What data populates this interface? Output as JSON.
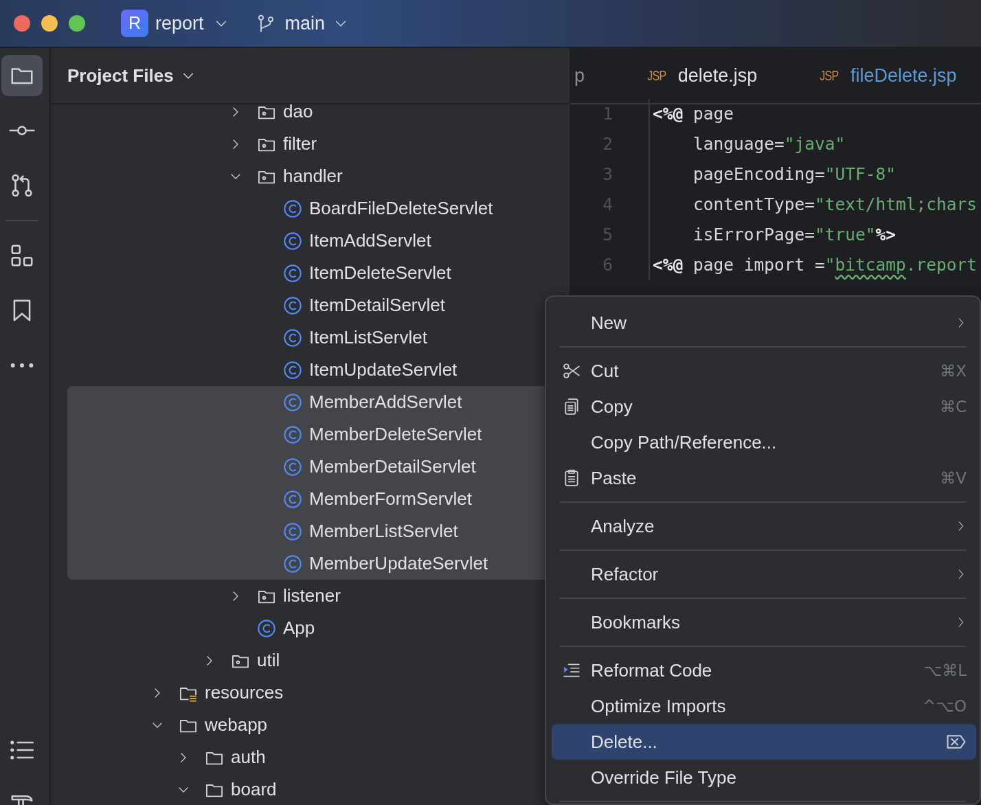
{
  "title_bar": {
    "project": {
      "badge": "R",
      "name": "report"
    },
    "branch": {
      "name": "main"
    }
  },
  "tool_buttons": [
    {
      "selected": true
    },
    {
      "selected": false
    },
    {
      "selected": false
    },
    {
      "selected": false
    },
    {
      "selected": false
    },
    {
      "selected": false
    },
    {
      "selected": false
    },
    {
      "selected": false
    }
  ],
  "project_panel": {
    "title": "Project Files",
    "tree": [
      {
        "children": [
          {
            "children": [
              {
                "children": [
                  {
                    "label": "dao",
                    "kind": "package",
                    "expanded": false,
                    "selected": false
                  },
                  {
                    "label": "filter",
                    "kind": "package",
                    "expanded": false,
                    "selected": false
                  },
                  {
                    "label": "handler",
                    "kind": "package",
                    "expanded": true,
                    "selected": false,
                    "children": [
                      {
                        "label": "BoardFileDeleteServlet",
                        "kind": "class",
                        "selected": false
                      },
                      {
                        "label": "ItemAddServlet",
                        "kind": "class",
                        "selected": false
                      },
                      {
                        "label": "ItemDeleteServlet",
                        "kind": "class",
                        "selected": false
                      },
                      {
                        "label": "ItemDetailServlet",
                        "kind": "class",
                        "selected": false
                      },
                      {
                        "label": "ItemListServlet",
                        "kind": "class",
                        "selected": false
                      },
                      {
                        "label": "ItemUpdateServlet",
                        "kind": "class",
                        "selected": false
                      },
                      {
                        "label": "MemberAddServlet",
                        "kind": "class",
                        "selected": true
                      },
                      {
                        "label": "MemberDeleteServlet",
                        "kind": "class",
                        "selected": true
                      },
                      {
                        "label": "MemberDetailServlet",
                        "kind": "class",
                        "selected": true
                      },
                      {
                        "label": "MemberFormServlet",
                        "kind": "class",
                        "selected": true
                      },
                      {
                        "label": "MemberListServlet",
                        "kind": "class",
                        "selected": true
                      },
                      {
                        "label": "MemberUpdateServlet",
                        "kind": "class",
                        "selected": true
                      }
                    ]
                  },
                  {
                    "label": "listener",
                    "kind": "package",
                    "expanded": false,
                    "selected": false
                  },
                  {
                    "label": "App",
                    "kind": "class",
                    "selected": false
                  }
                ]
              },
              {
                "label": "util",
                "kind": "package",
                "expanded": false,
                "selected": false
              }
            ]
          }
        ]
      },
      {
        "label": "resources",
        "kind": "resources",
        "expanded": false,
        "selected": false
      },
      {
        "label": "webapp",
        "kind": "folder",
        "expanded": true,
        "selected": false,
        "children": [
          {
            "label": "auth",
            "kind": "folder",
            "expanded": false,
            "selected": false
          },
          {
            "label": "board",
            "kind": "folder",
            "expanded": true,
            "selected": false
          }
        ]
      }
    ]
  },
  "editor": {
    "tabs": [
      {
        "label": "p",
        "color": "#8c8f94"
      },
      {
        "badge": "JSP",
        "label": "delete.jsp",
        "color": "#dfe1e5"
      },
      {
        "badge": "JSP",
        "label": "fileDelete.jsp",
        "color": "#5c9ad6"
      }
    ],
    "lines": [
      {
        "number": "1",
        "tokens": [
          {
            "text": "<%@",
            "kind": "directive"
          },
          {
            "text": " page",
            "kind": "plain"
          }
        ]
      },
      {
        "number": "2",
        "tokens": [
          {
            "text": "    language=",
            "kind": "plain"
          },
          {
            "text": "\"java\"",
            "kind": "string"
          }
        ]
      },
      {
        "number": "3",
        "tokens": [
          {
            "text": "    pageEncoding=",
            "kind": "plain"
          },
          {
            "text": "\"UTF-8\"",
            "kind": "string"
          }
        ]
      },
      {
        "number": "4",
        "tokens": [
          {
            "text": "    contentType=",
            "kind": "plain"
          },
          {
            "text": "\"text/html;chars",
            "kind": "string"
          }
        ]
      },
      {
        "number": "5",
        "tokens": [
          {
            "text": "    isErrorPage=",
            "kind": "plain"
          },
          {
            "text": "\"true\"",
            "kind": "string"
          },
          {
            "text": "%>",
            "kind": "directive"
          }
        ]
      },
      {
        "number": "6",
        "tokens": [
          {
            "text": "<%@",
            "kind": "directive"
          },
          {
            "text": " page import =",
            "kind": "plain"
          },
          {
            "text": "\"",
            "kind": "string"
          },
          {
            "text": "bitcamp",
            "kind": "warning"
          },
          {
            "text": ".report",
            "kind": "string"
          }
        ]
      }
    ]
  },
  "context_menu": [
    {
      "kind": "submenu",
      "label": "New",
      "selected": false
    },
    {
      "kind": "separator"
    },
    {
      "kind": "action",
      "label": "Cut",
      "shortcut": "⌘X",
      "selected": false
    },
    {
      "kind": "action",
      "label": "Copy",
      "shortcut": "⌘C",
      "selected": false
    },
    {
      "kind": "action",
      "label": "Copy Path/Reference...",
      "selected": false
    },
    {
      "kind": "action",
      "label": "Paste",
      "shortcut": "⌘V",
      "selected": false
    },
    {
      "kind": "separator"
    },
    {
      "kind": "submenu",
      "label": "Analyze",
      "selected": false
    },
    {
      "kind": "separator"
    },
    {
      "kind": "submenu",
      "label": "Refactor",
      "selected": false
    },
    {
      "kind": "separator"
    },
    {
      "kind": "submenu",
      "label": "Bookmarks",
      "selected": false
    },
    {
      "kind": "separator"
    },
    {
      "kind": "action",
      "label": "Reformat Code",
      "shortcut": "⌥⌘L",
      "selected": false
    },
    {
      "kind": "action",
      "label": "Optimize Imports",
      "shortcut": "^⌥O",
      "selected": false
    },
    {
      "kind": "action",
      "label": "Delete...",
      "selected": true
    },
    {
      "kind": "action",
      "label": "Override File Type",
      "selected": false
    },
    {
      "kind": "separator"
    }
  ]
}
